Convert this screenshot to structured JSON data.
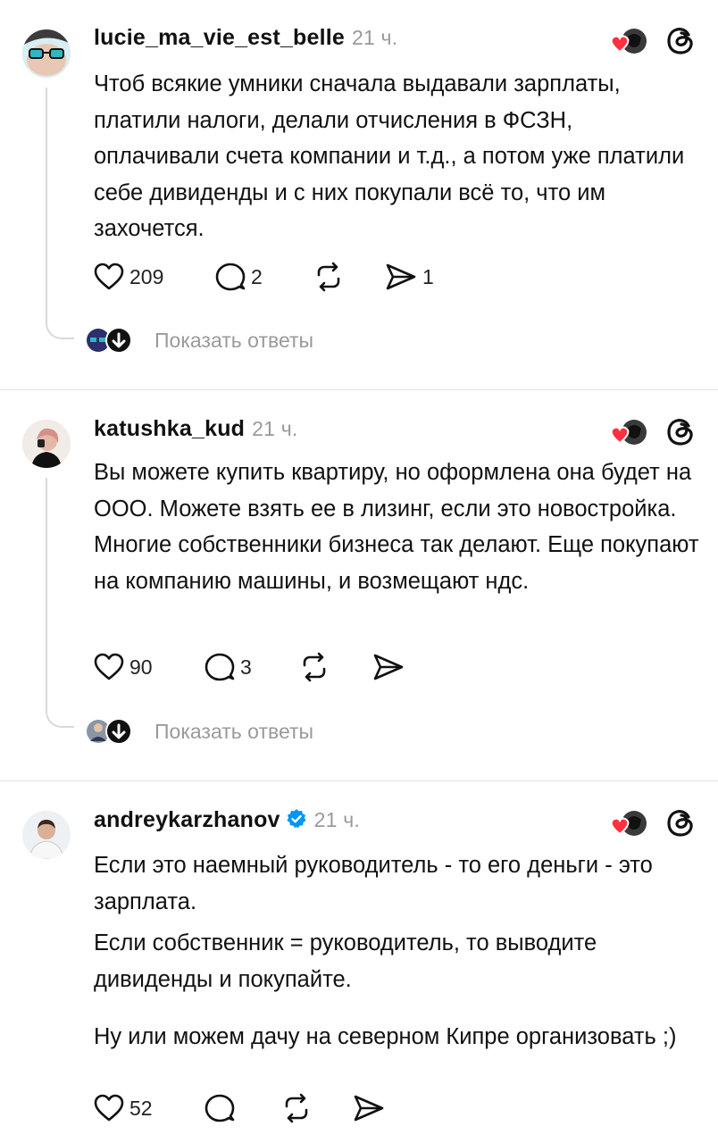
{
  "posts": [
    {
      "username": "lucie_ma_vie_est_belle",
      "time": "21 ч.",
      "verified": false,
      "body": [
        "Чтоб всякие умники сначала выдавали зарплаты, платили налоги, делали отчисления в ФСЗН, оплачивали счета компании и т.д., а потом уже платили себе дивиденды и с них покупали всё то, что им захочется."
      ],
      "likes": "209",
      "replies": "2",
      "reposts": "",
      "shares": "1",
      "show_replies": "Показать ответы"
    },
    {
      "username": "katushka_kud",
      "time": "21 ч.",
      "verified": false,
      "body": [
        "Вы можете купить квартиру, но оформлена она будет на ООО. Можете взять ее в лизинг, если это новостройка. Многие собственники бизнеса так делают. Еще покупают на компанию машины, и возмещают ндс."
      ],
      "likes": "90",
      "replies": "3",
      "reposts": "",
      "shares": "",
      "show_replies": "Показать ответы"
    },
    {
      "username": "andreykarzhanov",
      "time": "21 ч.",
      "verified": true,
      "body": [
        "Если это наемный руководитель - то его деньги - это зарплата.",
        "Если собственник = руководитель, то выводите дивиденды и покупайте.",
        "Ну или можем дачу на северном Кипре организовать ;)"
      ],
      "likes": "52",
      "replies": "",
      "reposts": "",
      "shares": ""
    }
  ],
  "icons": {
    "like": "heart-outline-icon",
    "reply": "speech-bubble-icon",
    "repost": "repost-arrows-icon",
    "share": "send-icon",
    "app": "threads-logo-icon",
    "verified": "verified-badge-icon"
  },
  "colors": {
    "heart": "#ff3040",
    "verified": "#0095f6",
    "muted": "#9a9a9a",
    "line": "#d9d9d9"
  }
}
